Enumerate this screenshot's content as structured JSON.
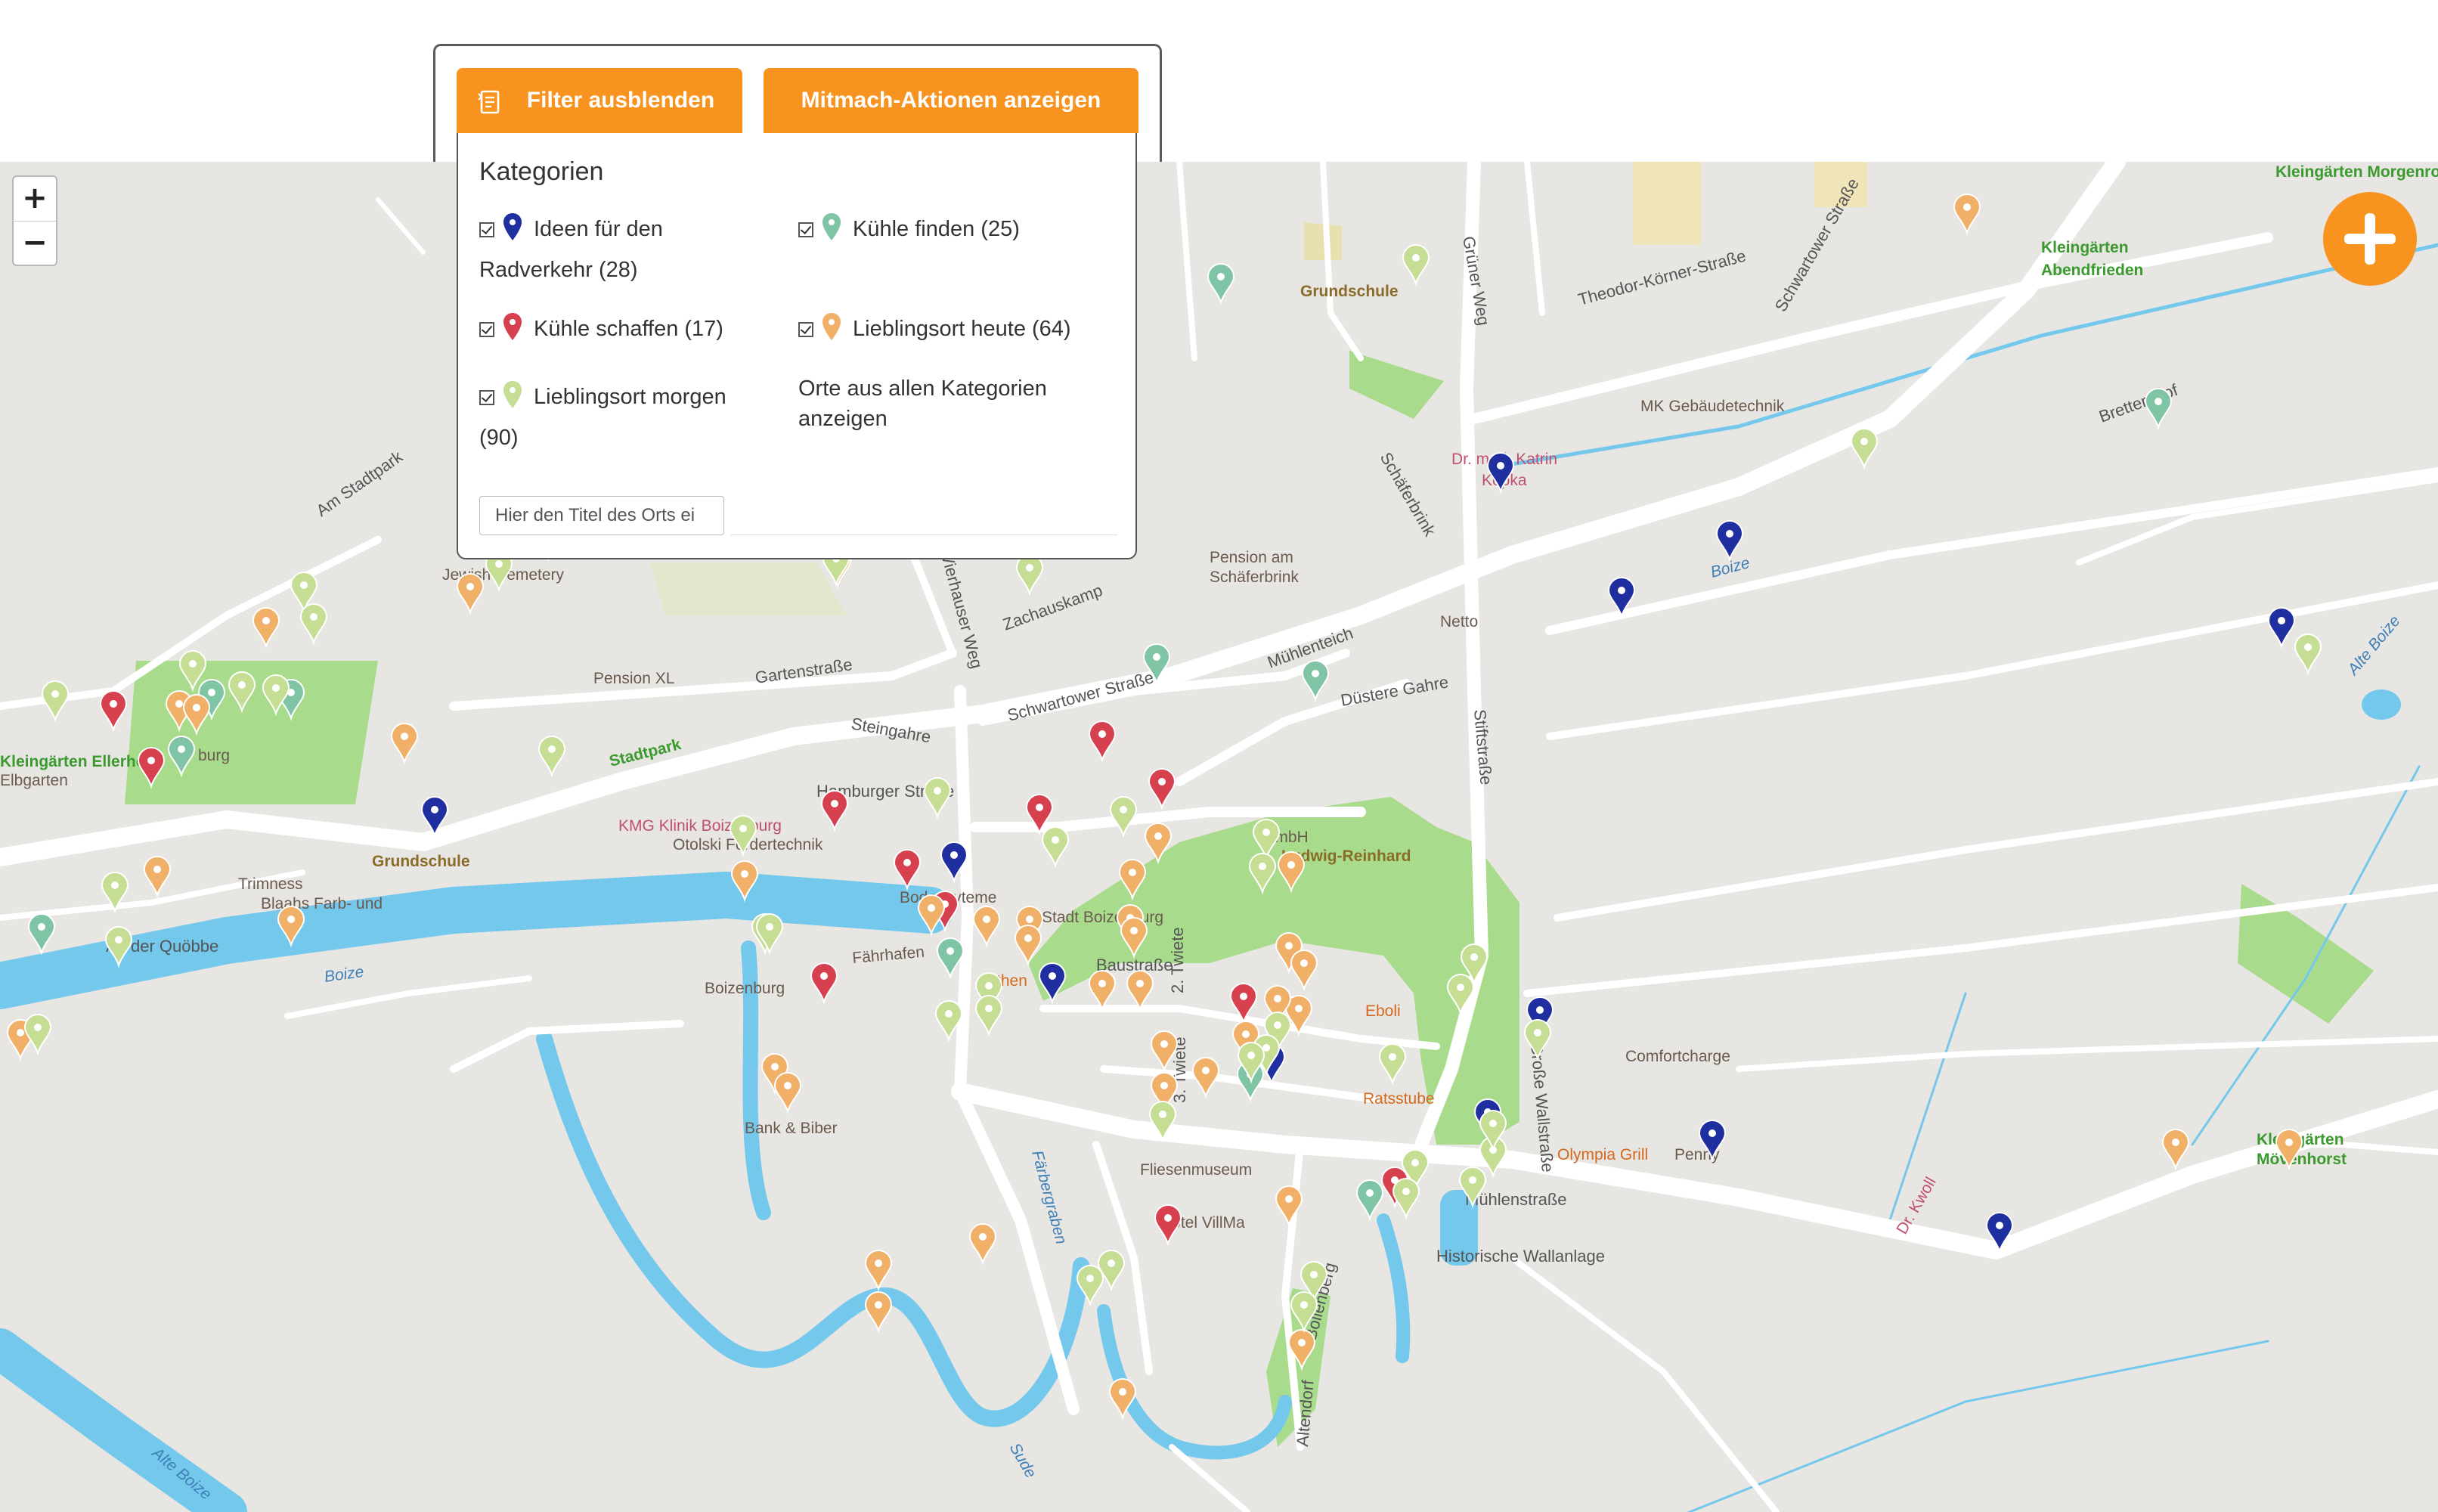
{
  "toolbar": {
    "filter_button": "Filter ausblenden",
    "actions_button": "Mitmach-Aktionen anzeigen"
  },
  "panel": {
    "heading": "Kategorien",
    "categories": [
      {
        "label_line1": "Ideen für den",
        "label_line2": "Radverkehr (28)",
        "color": "#1f2fa0",
        "checked": true
      },
      {
        "label_line1": "Kühle finden (25)",
        "label_line2": "",
        "color": "#7ec4a5",
        "checked": true
      },
      {
        "label_line1": "Kühle schaffen (17)",
        "label_line2": "",
        "color": "#d6404f",
        "checked": true
      },
      {
        "label_line1": "Lieblingsort heute (64)",
        "label_line2": "",
        "color": "#f0b068",
        "checked": true
      },
      {
        "label_line1": "Lieblingsort morgen",
        "label_line2": "(90)",
        "color": "#c6dd94",
        "checked": true
      }
    ],
    "show_all_line1": "Orte aus allen Kategorien",
    "show_all_line2": "anzeigen",
    "search_placeholder": "Hier den Titel des Orts ei"
  },
  "zoom": {
    "in": "+",
    "out": "−"
  },
  "map": {
    "colors": {
      "background": "#e8e6e3",
      "road": "#ffffff",
      "water": "#74c8ec",
      "park": "#a8dc8c",
      "pin_blue": "#1f2fa0",
      "pin_teal": "#7ec4a5",
      "pin_red": "#d6404f",
      "pin_orange": "#f0b068",
      "pin_lime": "#c6dd94"
    },
    "labels": [
      {
        "text": "Kleingärten Morgenrot",
        "kind": "green"
      },
      {
        "text": "Kleingärten",
        "kind": "green"
      },
      {
        "text": "Abendfrieden",
        "kind": "green"
      },
      {
        "text": "Grundschule",
        "kind": "brown"
      },
      {
        "text": "Grüner Weg",
        "kind": "street"
      },
      {
        "text": "Theodor-Körner-Straße",
        "kind": "street"
      },
      {
        "text": "Schwartower Straße",
        "kind": "street"
      },
      {
        "text": "MK Gebäudetechnik",
        "kind": "poi"
      },
      {
        "text": "Bretternhof",
        "kind": "street"
      },
      {
        "text": "Boize",
        "kind": "water"
      },
      {
        "text": "Dr. med. Katrin",
        "kind": "health"
      },
      {
        "text": "Kopka",
        "kind": "health"
      },
      {
        "text": "Schäferbrink",
        "kind": "street"
      },
      {
        "text": "Am Stadtpark",
        "kind": "street"
      },
      {
        "text": "Pension am",
        "kind": "poi"
      },
      {
        "text": "Schäferbrink",
        "kind": "poi"
      },
      {
        "text": "Netto",
        "kind": "poi"
      },
      {
        "text": "Zachauskamp",
        "kind": "street"
      },
      {
        "text": "Jewish Cemetery",
        "kind": "poi"
      },
      {
        "text": "Pension XL",
        "kind": "poi"
      },
      {
        "text": "Gartenstraße",
        "kind": "street"
      },
      {
        "text": "Vierhauser Weg",
        "kind": "street"
      },
      {
        "text": "Mühlenteich",
        "kind": "street"
      },
      {
        "text": "Düstere Gahre",
        "kind": "street"
      },
      {
        "text": "Stiftstraße",
        "kind": "street"
      },
      {
        "text": "Schwartower Straße",
        "kind": "street"
      },
      {
        "text": "Alte Boize",
        "kind": "water"
      },
      {
        "text": "Steingahre",
        "kind": "street"
      },
      {
        "text": "Kleingärten Ellerholz",
        "kind": "green"
      },
      {
        "text": "Elbgarten",
        "kind": "poi"
      },
      {
        "text": "burg",
        "kind": "poi"
      },
      {
        "text": "Stadtpark",
        "kind": "green"
      },
      {
        "text": "Hamburger Straße",
        "kind": "street"
      },
      {
        "text": "KMG Klinik Boizenburg",
        "kind": "health"
      },
      {
        "text": "Otolski Fördertechnik",
        "kind": "poi"
      },
      {
        "text": "GmbH",
        "kind": "poi"
      },
      {
        "text": "Ludwig-Reinhard",
        "kind": "brown"
      },
      {
        "text": "Grundschule",
        "kind": "brown"
      },
      {
        "text": "Trimness",
        "kind": "poi"
      },
      {
        "text": "Blaahs Farb- und",
        "kind": "poi"
      },
      {
        "text": "Bodensyteme",
        "kind": "poi"
      },
      {
        "text": "Stadt Boizenburg",
        "kind": "poi"
      },
      {
        "text": "Große Wallstraße",
        "kind": "street"
      },
      {
        "text": "An der Quöbbe",
        "kind": "street"
      },
      {
        "text": "Fährhafen",
        "kind": "poi"
      },
      {
        "text": "Boize",
        "kind": "water"
      },
      {
        "text": "Athen",
        "kind": "food"
      },
      {
        "text": "Baustraße",
        "kind": "street"
      },
      {
        "text": "Eboli",
        "kind": "food"
      },
      {
        "text": "Boizenburg",
        "kind": "poi"
      },
      {
        "text": "2. Twiete",
        "kind": "street"
      },
      {
        "text": "Comfortcharge",
        "kind": "poi"
      },
      {
        "text": "Ratsstube",
        "kind": "food"
      },
      {
        "text": "3. Twiete",
        "kind": "street"
      },
      {
        "text": "Bank & Biber",
        "kind": "poi"
      },
      {
        "text": "Fliesenmuseum",
        "kind": "poi"
      },
      {
        "text": "Olympia Grill",
        "kind": "food"
      },
      {
        "text": "Penny",
        "kind": "poi"
      },
      {
        "text": "Kleingärten",
        "kind": "green"
      },
      {
        "text": "Mövenhorst",
        "kind": "green"
      },
      {
        "text": "Färbergraben",
        "kind": "water"
      },
      {
        "text": "Mühlenstraße",
        "kind": "street"
      },
      {
        "text": "Hotel VillMa",
        "kind": "poi"
      },
      {
        "text": "Bollenberg",
        "kind": "street"
      },
      {
        "text": "Historische Wallanlage",
        "kind": "street"
      },
      {
        "text": "Dr. Kwoll",
        "kind": "health"
      },
      {
        "text": "Alte Boize",
        "kind": "water"
      },
      {
        "text": "Sude",
        "kind": "water"
      },
      {
        "text": "Altendorf",
        "kind": "street"
      }
    ]
  }
}
